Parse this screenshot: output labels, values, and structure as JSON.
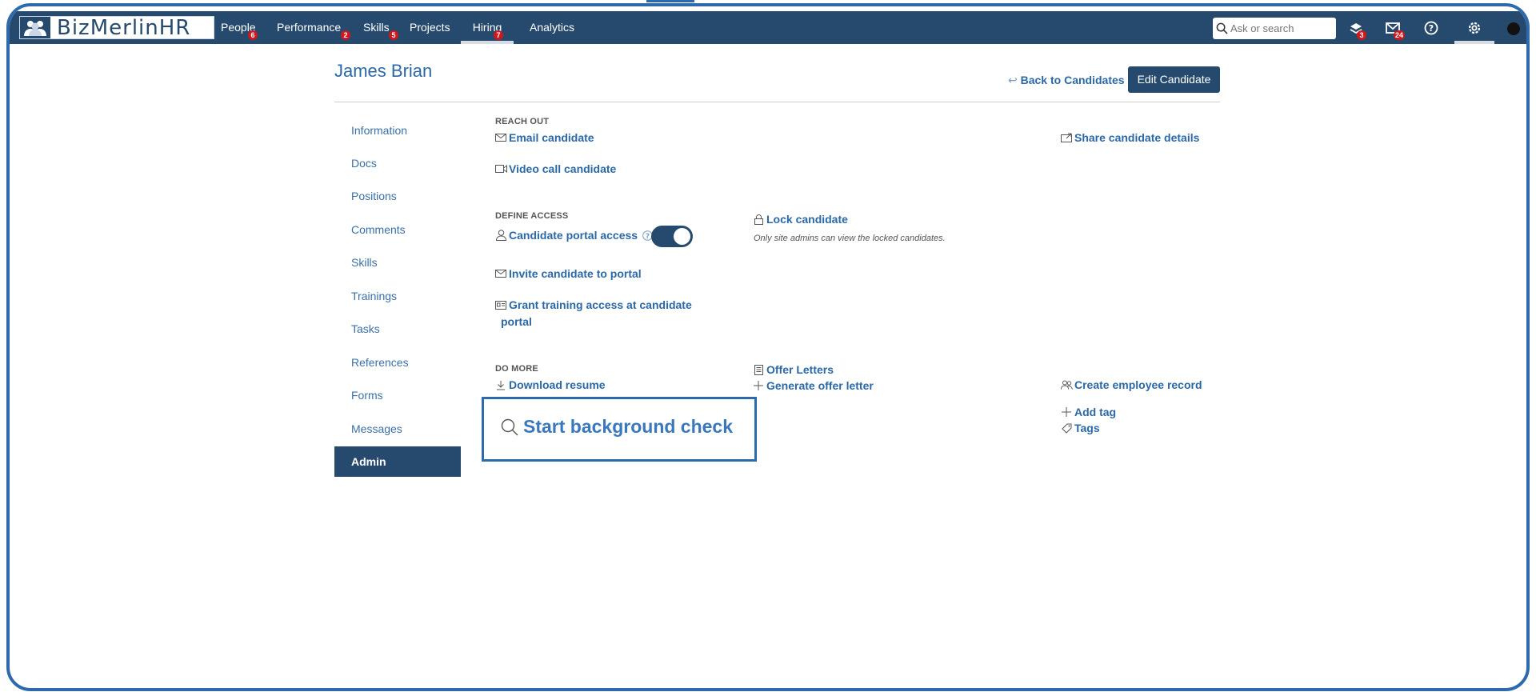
{
  "app": {
    "logo_text": "BizMerlinHR"
  },
  "nav": {
    "items": [
      {
        "label": "People",
        "badge": "6"
      },
      {
        "label": "Performance",
        "badge": "2"
      },
      {
        "label": "Skills",
        "badge": "5"
      },
      {
        "label": "Projects",
        "badge": ""
      },
      {
        "label": "Hiring",
        "badge": "7"
      },
      {
        "label": "Analytics",
        "badge": ""
      }
    ],
    "search_placeholder": "Ask or search",
    "notifications_badge": "3",
    "messages_badge": "24"
  },
  "page": {
    "title": "James Brian",
    "back_label": "Back to Candidates",
    "edit_label": "Edit Candidate"
  },
  "sidebar": {
    "items": [
      {
        "label": "Information"
      },
      {
        "label": "Docs"
      },
      {
        "label": "Positions"
      },
      {
        "label": "Comments"
      },
      {
        "label": "Skills"
      },
      {
        "label": "Trainings"
      },
      {
        "label": "Tasks"
      },
      {
        "label": "References"
      },
      {
        "label": "Forms"
      },
      {
        "label": "Messages"
      },
      {
        "label": "Admin"
      }
    ]
  },
  "reach_out": {
    "heading": "REACH OUT",
    "email": "Email candidate",
    "video": "Video call candidate",
    "share": "Share candidate details"
  },
  "define_access": {
    "heading": "DEFINE ACCESS",
    "portal_access": "Candidate portal access",
    "portal_access_enabled": true,
    "lock": "Lock candidate",
    "lock_hint": "Only site admins can view the locked candidates.",
    "invite": "Invite candidate to portal",
    "grant_line1": "Grant training access at candidate",
    "grant_line2": "portal"
  },
  "do_more": {
    "heading": "DO MORE",
    "download_resume": "Download resume",
    "offer_letters": "Offer Letters",
    "generate_offer": "Generate offer letter",
    "create_employee": "Create employee record",
    "add_tag": "Add tag",
    "tags": "Tags",
    "background_check": "Start background check"
  },
  "colors": {
    "nav_bg": "#264a6e",
    "link": "#2a68a8",
    "badge": "#d0181c",
    "frame": "#2f69ad"
  }
}
